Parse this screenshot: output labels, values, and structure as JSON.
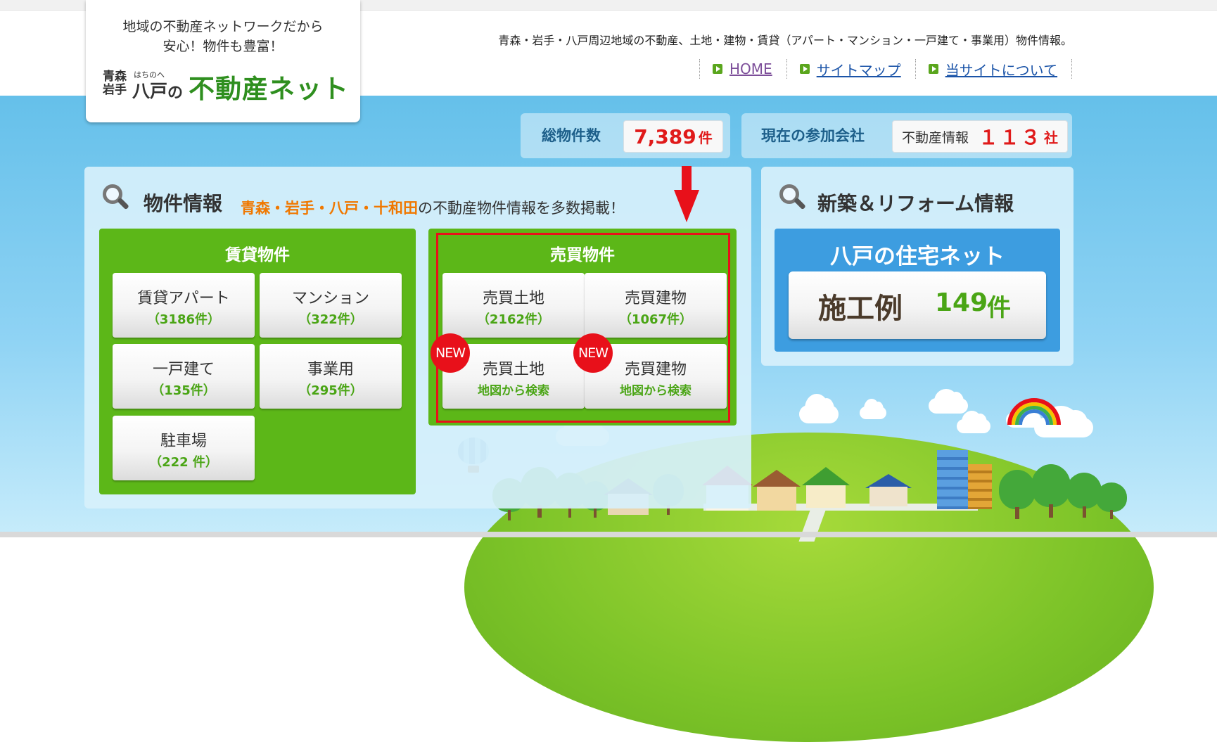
{
  "logo": {
    "tagline_line1": "地域の不動産ネットワークだから",
    "tagline_line2": "安心！物件も豊富！",
    "aomori": "青森",
    "iwate": "岩手",
    "ruby": "はちのへ",
    "hachinohe": "八戸",
    "no": "の",
    "main": "不動産ネット"
  },
  "header": {
    "description": "青森・岩手・八戸周辺地域の不動産、土地・建物・賃貸（アパート・マンション・一戸建て・事業用）物件情報。",
    "nav": [
      {
        "label": "HOME"
      },
      {
        "label": "サイトマップ"
      },
      {
        "label": "当サイトについて"
      }
    ]
  },
  "stats": {
    "total_label": "総物件数",
    "total_value": "7,389",
    "total_unit": "件",
    "members_label": "現在の参加会社",
    "members_sub": "不動産情報",
    "members_value": "１１３",
    "members_unit": "社"
  },
  "property": {
    "title": "物件情報",
    "areas": "青森・岩手・八戸・十和田",
    "areas_suffix": "の不動産物件情報を多数掲載！",
    "rental": {
      "header": "賃貸物件",
      "items": [
        {
          "label": "賃貸アパート",
          "count": "（3186件）"
        },
        {
          "label": "マンション",
          "count": "（322件）"
        },
        {
          "label": "一戸建て",
          "count": "（135件）"
        },
        {
          "label": "事業用",
          "count": "（295件）"
        },
        {
          "label": "駐車場",
          "count": "（222 件）"
        }
      ]
    },
    "sale": {
      "header": "売買物件",
      "items": [
        {
          "label": "売買土地",
          "sub": "（2162件）"
        },
        {
          "label": "売買建物",
          "sub": "（1067件）"
        },
        {
          "label": "売買土地",
          "sub": "地図から検索",
          "badge": "NEW"
        },
        {
          "label": "売買建物",
          "sub": "地図から検索",
          "badge": "NEW"
        }
      ]
    }
  },
  "reform": {
    "title": "新築＆リフォーム情報",
    "network": "八戸の住宅ネット",
    "case_label": "施工例",
    "case_count": "149",
    "case_unit": "件"
  },
  "colors": {
    "green": "#5cb718",
    "accent_red": "#e8101a",
    "orange": "#f07800",
    "blue": "#3d9de0",
    "link": "#1b54a8"
  },
  "icons": [
    "magnifier-icon",
    "play-square-icon",
    "down-arrow-icon",
    "new-badge"
  ]
}
